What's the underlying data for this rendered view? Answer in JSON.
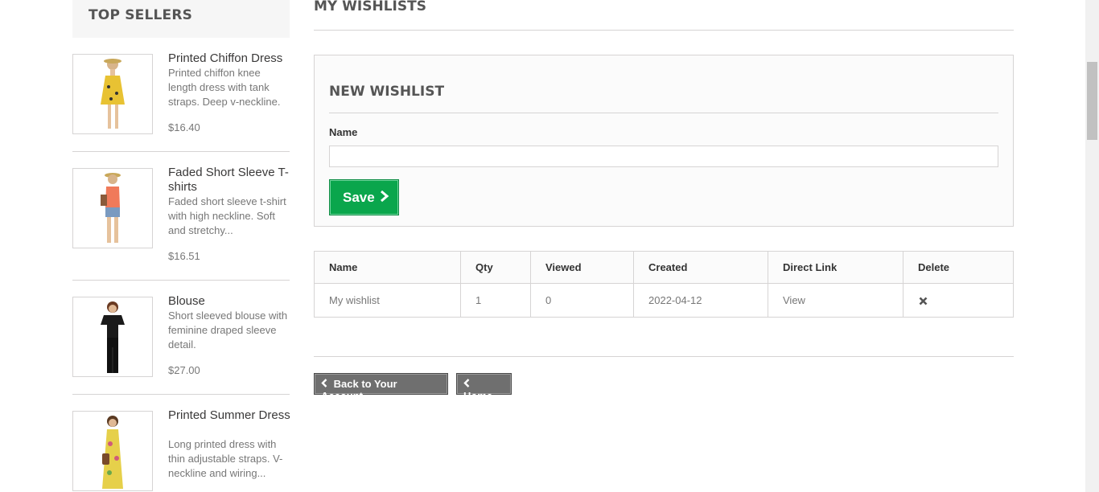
{
  "sidebar": {
    "title": "TOP SELLERS",
    "products": [
      {
        "name": "Printed Chiffon Dress",
        "desc": "Printed chiffon knee length dress with tank straps. Deep v-neckline.",
        "price": "$16.40"
      },
      {
        "name": "Faded Short Sleeve T-shirts",
        "desc": "Faded short sleeve t-shirt with high neckline. Soft and stretchy...",
        "price": "$16.51"
      },
      {
        "name": "Blouse",
        "desc": "Short sleeved blouse with feminine draped sleeve detail.",
        "price": "$27.00"
      },
      {
        "name": "Printed Summer Dress",
        "desc": "Long printed dress with thin adjustable straps. V-neckline and wiring...",
        "price": ""
      }
    ]
  },
  "main": {
    "heading": "MY WISHLISTS",
    "new_wishlist": {
      "title": "NEW WISHLIST",
      "name_label": "Name",
      "name_value": "",
      "save_label": "Save"
    },
    "table": {
      "headers": [
        "Name",
        "Qty",
        "Viewed",
        "Created",
        "Direct Link",
        "Delete"
      ],
      "rows": [
        [
          "My wishlist",
          "1",
          "0",
          "2022-04-12",
          "View",
          ""
        ]
      ]
    },
    "back_label": "Back to Your Account",
    "home_label": "Home"
  },
  "icons": {
    "delete": "close-icon",
    "chevron": "chevron-right-icon",
    "back_chevron": "chevron-left-icon"
  },
  "colors": {
    "save_button": "#0aa64c",
    "dark_button": "#6f6f6f"
  }
}
